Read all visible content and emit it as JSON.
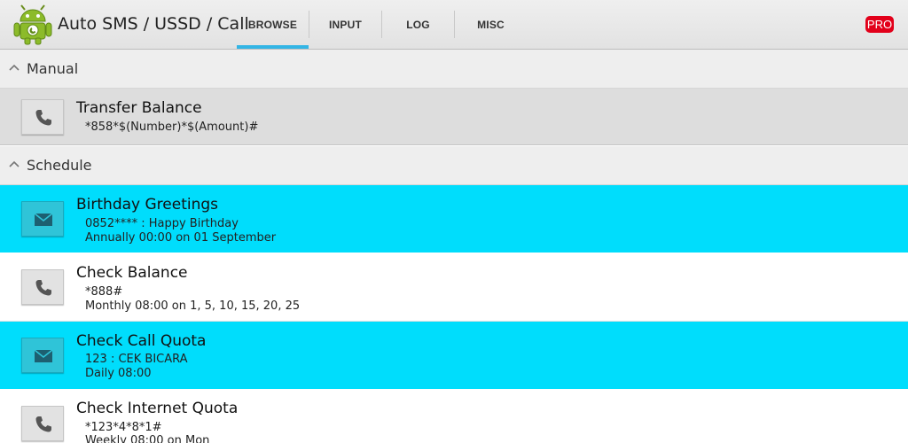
{
  "app": {
    "title": "Auto SMS / USSD / Call",
    "icon": "android-robot-icon",
    "pro_badge": "PRO"
  },
  "tabs": [
    {
      "label": "BROWSE",
      "selected": true
    },
    {
      "label": "INPUT",
      "selected": false
    },
    {
      "label": "LOG",
      "selected": false
    },
    {
      "label": "MISC",
      "selected": false
    }
  ],
  "colors": {
    "accent": "#33b5e5",
    "highlight_row": "#00ddfc",
    "pro_badge": "#e2001a"
  },
  "sections": {
    "manual": {
      "title": "Manual",
      "items": [
        {
          "type": "call",
          "icon": "phone-icon",
          "title": "Transfer Balance",
          "lines": [
            "*858*$(Number)*$(Amount)#"
          ]
        }
      ]
    },
    "schedule": {
      "title": "Schedule",
      "items": [
        {
          "type": "sms",
          "icon": "envelope-icon",
          "highlighted": true,
          "title": "Birthday Greetings",
          "lines": [
            "0852**** : Happy Birthday",
            "Annually 00:00 on 01 September"
          ]
        },
        {
          "type": "call",
          "icon": "phone-icon",
          "highlighted": false,
          "title": "Check Balance",
          "lines": [
            "*888#",
            "Monthly 08:00 on 1, 5, 10, 15, 20, 25"
          ]
        },
        {
          "type": "sms",
          "icon": "envelope-icon",
          "highlighted": true,
          "title": "Check Call Quota",
          "lines": [
            "123 : CEK BICARA",
            "Daily 08:00"
          ]
        },
        {
          "type": "call",
          "icon": "phone-icon",
          "highlighted": false,
          "title": "Check Internet Quota",
          "lines": [
            "*123*4*8*1#",
            "Weekly 08:00 on Mon"
          ]
        }
      ]
    }
  }
}
